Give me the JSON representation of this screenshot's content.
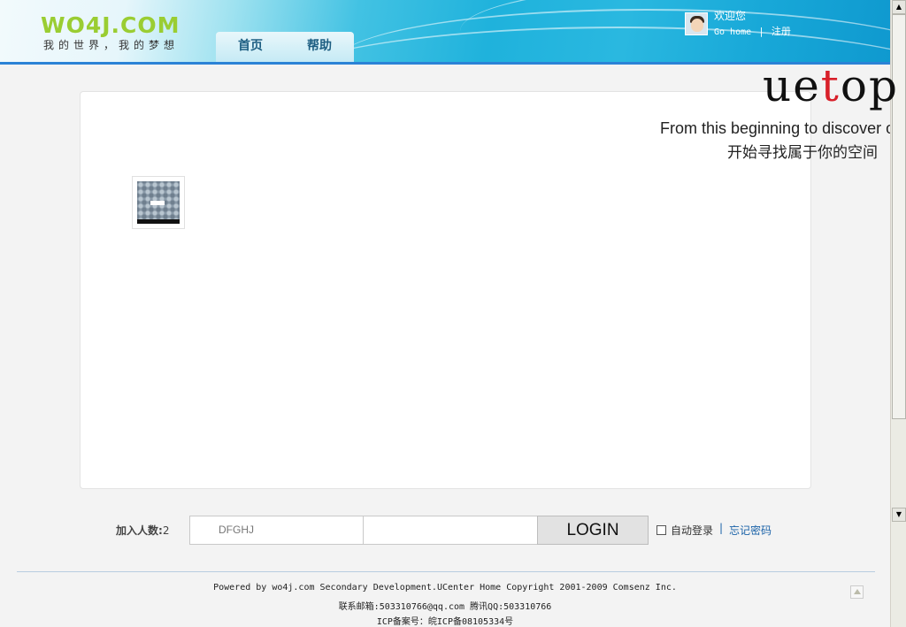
{
  "header": {
    "logo": "WO4J.COM",
    "slogan": "我的世界，我的梦想",
    "nav": [
      {
        "label": "首页"
      },
      {
        "label": "帮助"
      }
    ],
    "user": {
      "welcome": "欢迎您",
      "go_home": "Go home",
      "separator": "|",
      "register": "注册"
    }
  },
  "brand": {
    "logo_left": "ue",
    "logo_accent": "t",
    "logo_right": "op",
    "tagline_en": "From this beginning to discover of y",
    "tagline_cn": "开始寻找属于你的空间"
  },
  "login": {
    "join_label": "加入人数:",
    "join_count": "2",
    "username_value": "DFGHJ",
    "password_value": "",
    "button_label": "LOGIN",
    "auto_login": "自动登录",
    "separator": "|",
    "forgot": "忘记密码"
  },
  "footer": {
    "line1": "Powered by wo4j.com Secondary Development.UCenter Home Copyright 2001-2009 Comsenz Inc.",
    "line2": "联系邮箱:503310766@qq.com 腾讯QQ:503310766",
    "line3": "ICP备案号：皖ICP备08105334号"
  },
  "colors": {
    "header_accent": "#2b82d6",
    "logo_green": "#9acd32",
    "link_blue": "#1a62a8"
  }
}
